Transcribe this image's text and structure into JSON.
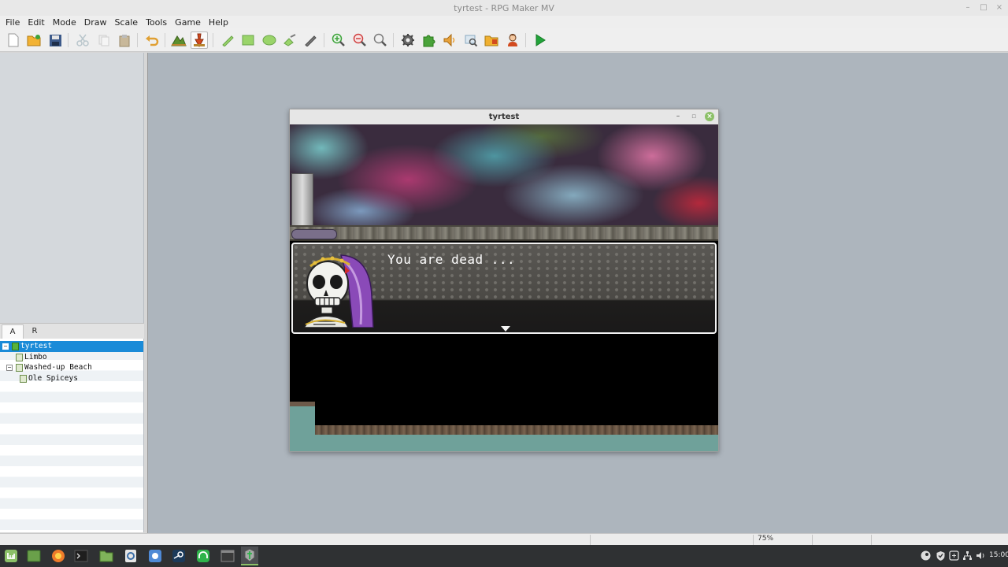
{
  "window": {
    "title": "tyrtest - RPG Maker MV",
    "controls": [
      "–",
      "□",
      "×"
    ]
  },
  "menu": [
    "File",
    "Edit",
    "Mode",
    "Draw",
    "Scale",
    "Tools",
    "Game",
    "Help"
  ],
  "toolbar": {
    "buttons": [
      {
        "name": "new-project-icon",
        "color": "#ffffff"
      },
      {
        "name": "open-project-icon",
        "color": "#f2b233"
      },
      {
        "name": "save-project-icon",
        "color": "#3d5a8a"
      },
      {
        "name": "cut-icon",
        "color": "#b9c6cc"
      },
      {
        "name": "copy-icon",
        "color": "#d9d9d9"
      },
      {
        "name": "paste-icon",
        "color": "#c8b89a"
      },
      {
        "name": "undo-icon",
        "color": "#e0a033"
      },
      {
        "name": "map-mode-icon",
        "color": "#5b8f2d"
      },
      {
        "name": "event-mode-icon",
        "color": "#d24a1e"
      },
      {
        "name": "pencil-icon",
        "color": "#9ad46a"
      },
      {
        "name": "rectangle-icon",
        "color": "#9ad46a"
      },
      {
        "name": "ellipse-icon",
        "color": "#9ad46a"
      },
      {
        "name": "flood-fill-icon",
        "color": "#9ad46a"
      },
      {
        "name": "shadow-pen-icon",
        "color": "#7a7a7a"
      },
      {
        "name": "zoom-in-icon",
        "color": "#3da33a"
      },
      {
        "name": "zoom-out-icon",
        "color": "#d04040"
      },
      {
        "name": "zoom-actual-icon",
        "color": "#7a7a7a"
      },
      {
        "name": "database-icon",
        "color": "#555555"
      },
      {
        "name": "plugin-manager-icon",
        "color": "#4aa33a"
      },
      {
        "name": "sound-test-icon",
        "color": "#e8a23a"
      },
      {
        "name": "event-searcher-icon",
        "color": "#8aa8c0"
      },
      {
        "name": "resource-manager-icon",
        "color": "#f0b030"
      },
      {
        "name": "character-generator-icon",
        "color": "#d24a1e"
      },
      {
        "name": "playtest-icon",
        "color": "#22a33a"
      }
    ]
  },
  "left_panel": {
    "tabs": [
      "A",
      "R"
    ],
    "tree": [
      {
        "label": "tyrtest",
        "level": 0,
        "type": "project",
        "expander": "−",
        "selected": true
      },
      {
        "label": "Limbo",
        "level": 1,
        "type": "map",
        "expander": "",
        "selected": false
      },
      {
        "label": "Washed-up Beach",
        "level": 1,
        "type": "map",
        "expander": "−",
        "selected": false
      },
      {
        "label": "Ole Spiceys",
        "level": 2,
        "type": "map",
        "expander": "",
        "selected": false
      }
    ]
  },
  "game_window": {
    "title": "tyrtest",
    "controls": [
      "–",
      "▫",
      "×"
    ],
    "message": "You are dead ...",
    "face_name": "skeleton-face"
  },
  "status": {
    "zoom": "75%"
  },
  "taskbar": {
    "apps": [
      {
        "name": "mint-menu-icon",
        "color": "#8cc068"
      },
      {
        "name": "show-desktop-icon",
        "color": "#6aa04a"
      },
      {
        "name": "firefox-icon",
        "color": "#ef7b2a"
      },
      {
        "name": "terminal-icon",
        "color": "#1e1e1e"
      },
      {
        "name": "files-icon",
        "color": "#7fb35a"
      },
      {
        "name": "app-icon",
        "color": "#e6e6e6"
      },
      {
        "name": "chromium-icon",
        "color": "#4f8ad6"
      },
      {
        "name": "steam-icon",
        "color": "#1b3a5a"
      },
      {
        "name": "headphones-app-icon",
        "color": "#2fb34a"
      },
      {
        "name": "window-icon",
        "color": "#3a3a3a"
      },
      {
        "name": "rpg-maker-icon",
        "color": "#a8a8a8"
      }
    ],
    "tray": [
      "steam-tray-icon",
      "shield-tray-icon",
      "update-tray-icon",
      "network-tray-icon",
      "volume-tray-icon"
    ],
    "clock": "15:00"
  }
}
